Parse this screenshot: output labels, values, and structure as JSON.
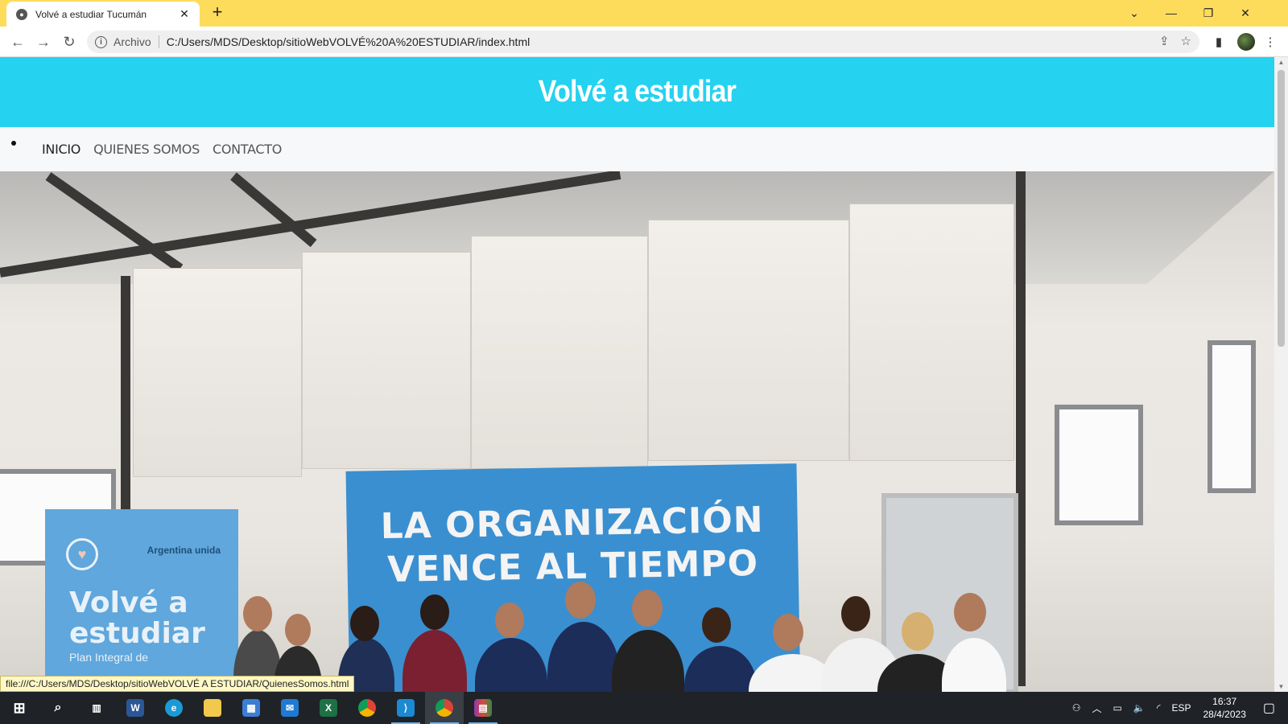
{
  "browser": {
    "tab_title": "Volvé a estudiar Tucumán",
    "url_scheme_label": "Archivo",
    "url": "C:/Users/MDS/Desktop/sitioWebVOLVÉ%20A%20ESTUDIAR/index.html",
    "status_link": "file:///C:/Users/MDS/Desktop/sitioWebVOLVÉ A ESTUDIAR/QuienesSomos.html"
  },
  "site": {
    "title": "Volvé a estudiar",
    "nav": [
      {
        "label": "INICIO"
      },
      {
        "label": "QUIENES SOMOS"
      },
      {
        "label": "CONTACTO"
      }
    ]
  },
  "hero_photo": {
    "banner_line1": "LA ORGANIZACIÓN",
    "banner_line2": "VENCE AL TIEMPO",
    "rollup_brand": "Argentina unida",
    "rollup_title_line1": "Volvé a",
    "rollup_title_line2": "estudiar",
    "rollup_sub": "Plan Integral de"
  },
  "taskbar": {
    "language": "ESP",
    "time": "16:37",
    "date": "28/4/2023"
  },
  "colors": {
    "chrome_titlebar": "#fddc5c",
    "site_header": "#25d2f0",
    "nav_bg": "#f7f8f9",
    "taskbar": "#1f2227"
  }
}
